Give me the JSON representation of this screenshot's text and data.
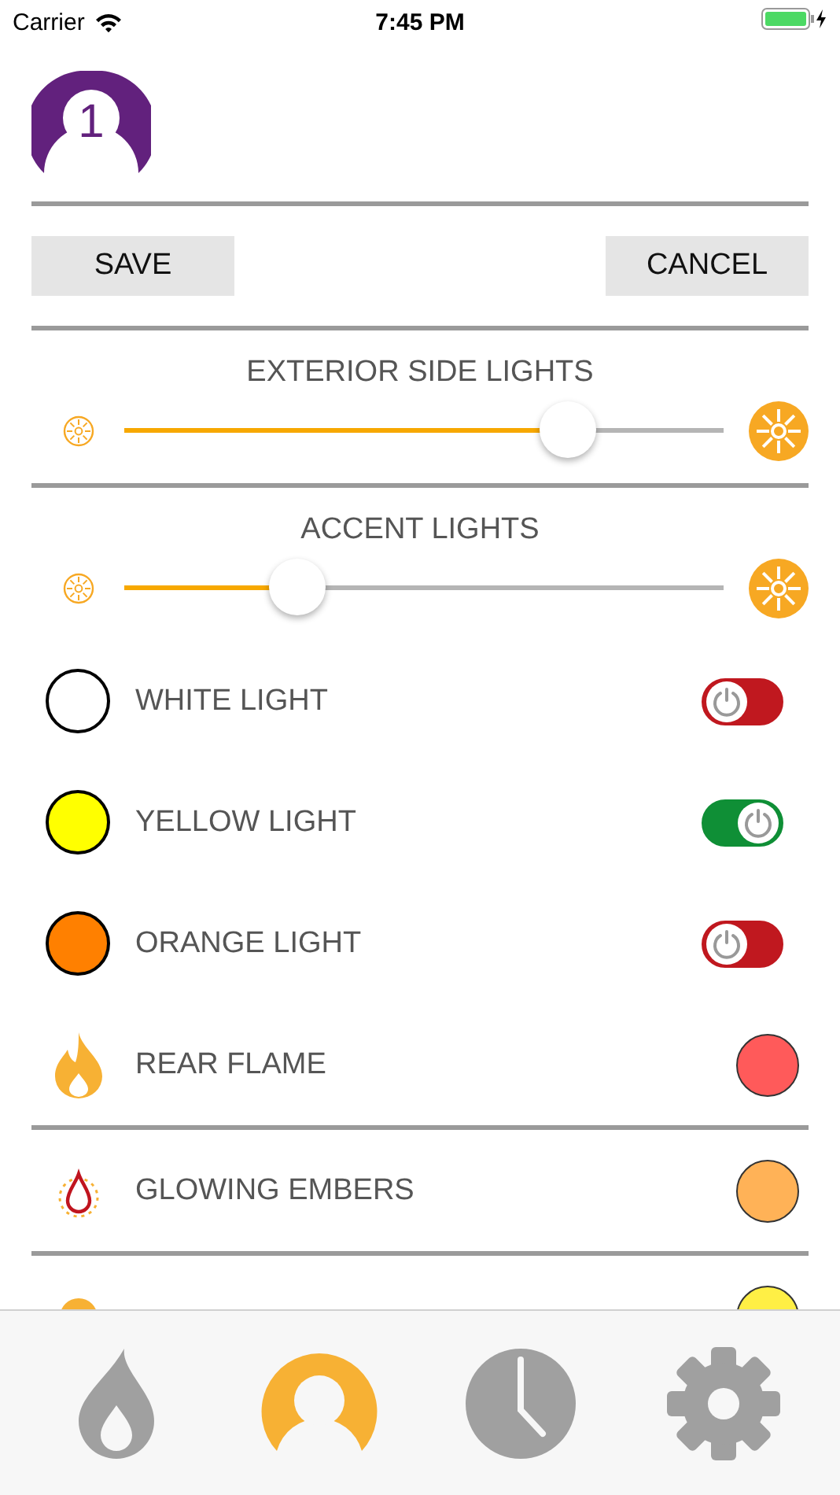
{
  "status_bar": {
    "carrier": "Carrier",
    "time": "7:45 PM"
  },
  "logo": {
    "digit": "1"
  },
  "buttons": [
    {
      "label": "SAVE"
    },
    {
      "label": "CANCEL"
    }
  ],
  "sliders": [
    {
      "title": "EXTERIOR SIDE LIGHTS",
      "level": 0.74
    },
    {
      "title": "ACCENT LIGHTS",
      "level": 0.29
    }
  ],
  "rows": [
    {
      "kind": "toggle",
      "label": "WHITE LIGHT",
      "color": "#ffffff",
      "on": false
    },
    {
      "kind": "toggle",
      "label": "YELLOW LIGHT",
      "color": "#ffff00",
      "on": true
    },
    {
      "kind": "toggle",
      "label": "ORANGE LIGHT",
      "color": "#ff8000",
      "on": false
    },
    {
      "kind": "flame",
      "label": "REAR FLAME",
      "color": "#ff5a5a",
      "divider": true
    },
    {
      "kind": "ember",
      "label": "GLOWING EMBERS",
      "color": "#ffb257",
      "divider": true
    },
    {
      "kind": "bulb",
      "color": "#ffef45",
      "divider": false
    }
  ],
  "tabs": [
    {
      "selected": false
    },
    {
      "selected": true
    },
    {
      "selected": false
    },
    {
      "selected": false
    }
  ]
}
